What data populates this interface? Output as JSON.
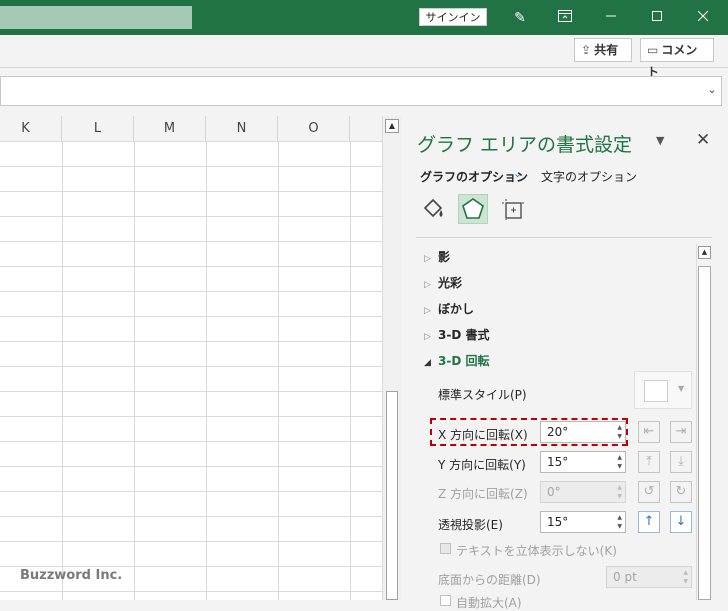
{
  "titlebar": {
    "signin_label": "サインイン",
    "icons": [
      "pen-icon",
      "ribbon-display-icon",
      "minimize-icon",
      "maximize-icon",
      "close-icon"
    ]
  },
  "ribbon": {
    "share_label": "共有",
    "comment_label": "コメント"
  },
  "sheet": {
    "columns": [
      "K",
      "L",
      "M",
      "N",
      "O"
    ],
    "watermark": "Buzzword Inc."
  },
  "pane": {
    "title": "グラフ エリアの書式設定",
    "tab_chart_options": "グラフのオプション",
    "tab_text_options": "文字のオプション",
    "sections": {
      "shadow": "影",
      "glow": "光彩",
      "soft_edges": "ぼかし",
      "format_3d": "3-D 書式",
      "rotation_3d": "3-D 回転"
    },
    "rotation": {
      "preset_label": "標準スタイル(P)",
      "x_label": "X 方向に回転(X)",
      "x_value": "20°",
      "y_label": "Y 方向に回転(Y)",
      "y_value": "15°",
      "z_label": "Z 方向に回転(Z)",
      "z_value": "0°",
      "perspective_label": "透視投影(E)",
      "perspective_value": "15°",
      "keep_text_flat_label": "テキストを立体表示しない(K)",
      "distance_label": "底面からの距離(D)",
      "distance_value": "0 pt",
      "autoscale_label": "自動拡大(A)"
    }
  }
}
